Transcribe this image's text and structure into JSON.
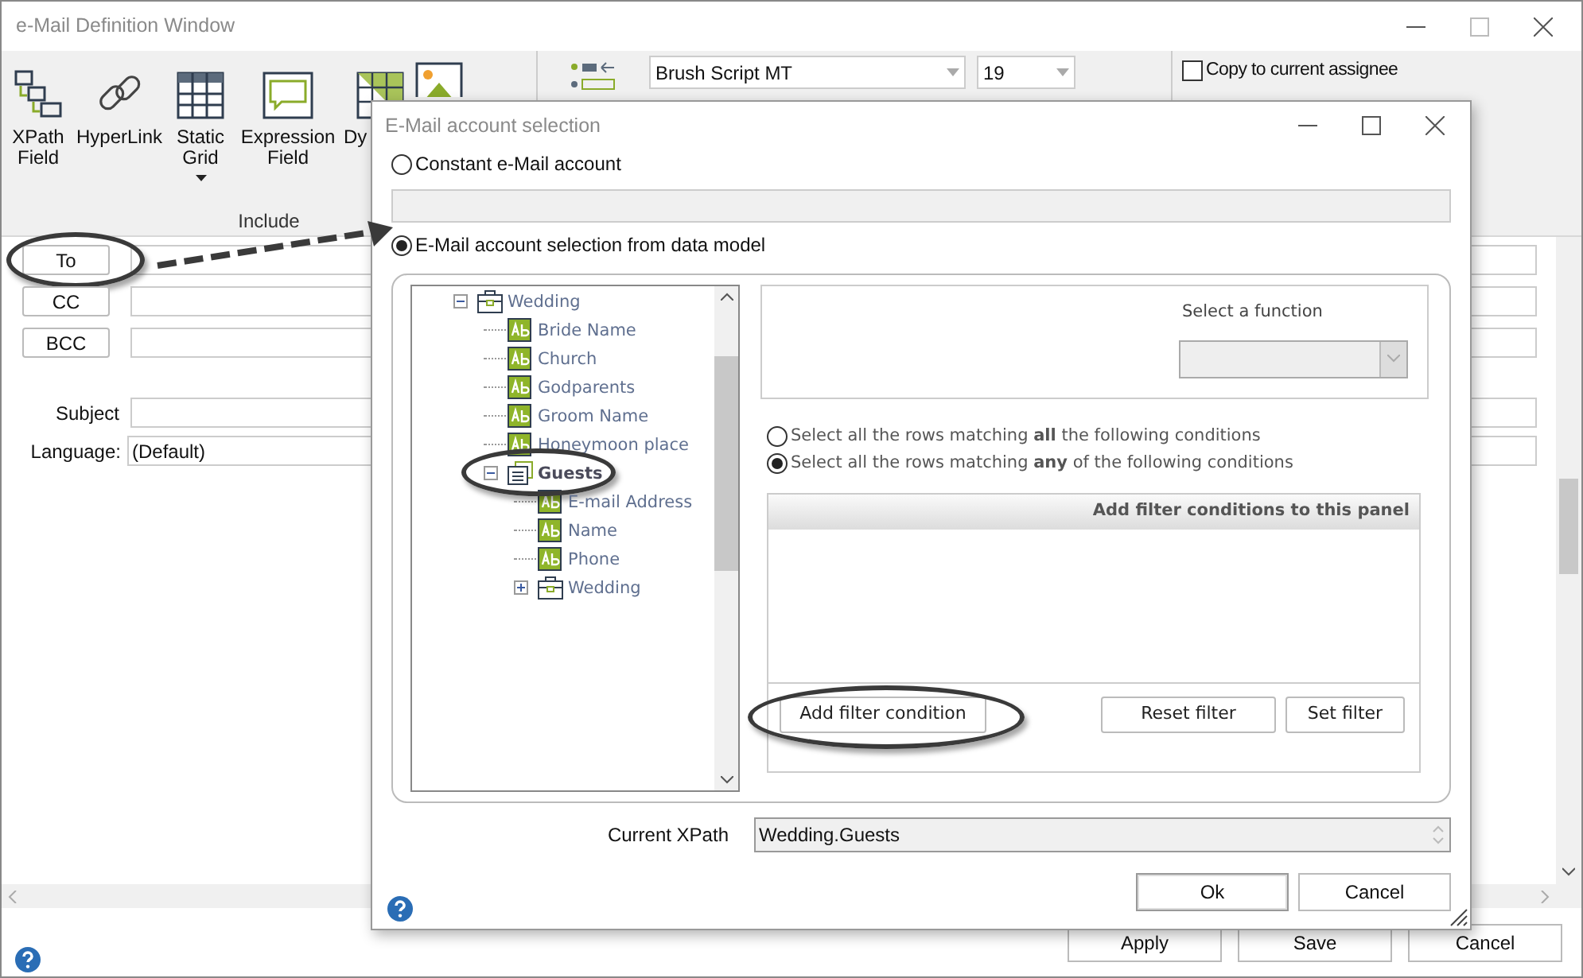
{
  "window": {
    "title": "e-Mail Definition Window"
  },
  "ribbon": {
    "items": [
      {
        "kind": "xpath",
        "lines": [
          "XPath",
          "Field"
        ]
      },
      {
        "kind": "link",
        "lines": [
          "HyperLink"
        ]
      },
      {
        "kind": "grid",
        "lines": [
          "Static",
          "Grid"
        ],
        "dropdown": true
      },
      {
        "kind": "expression",
        "lines": [
          "Expression",
          "Field"
        ]
      },
      {
        "kind": "dyngrid",
        "lines": [
          "Dy"
        ]
      },
      {
        "kind": "image"
      }
    ],
    "group_label": "Include",
    "font": {
      "value": "Brush Script MT"
    },
    "size": {
      "value": "19"
    },
    "copy_to_assignee": {
      "label": "Copy to current assignee",
      "checked": false
    }
  },
  "recipients": [
    {
      "label": "To",
      "highlighted": true
    },
    {
      "label": "CC",
      "highlighted": false
    },
    {
      "label": "BCC",
      "highlighted": false
    }
  ],
  "subject": {
    "label": "Subject"
  },
  "language": {
    "label": "Language:",
    "value": "(Default)"
  },
  "footer_buttons": [
    "Apply",
    "Save",
    "Cancel"
  ],
  "dialog": {
    "title": "E-Mail account selection",
    "sources": [
      {
        "label": "Constant e-Mail account",
        "selected": false
      },
      {
        "label": "E-Mail account selection from data model",
        "selected": true
      }
    ],
    "tree": [
      {
        "label": "Wedding",
        "kind": "group",
        "expanded": true,
        "selected": false,
        "highlighted": false,
        "children": [
          {
            "label": "Bride Name",
            "kind": "field",
            "selected": false,
            "highlighted": false
          },
          {
            "label": "Church",
            "kind": "field",
            "selected": false,
            "highlighted": false
          },
          {
            "label": "Godparents",
            "kind": "field",
            "selected": false,
            "highlighted": false
          },
          {
            "label": "Groom Name",
            "kind": "field",
            "selected": false,
            "highlighted": false
          },
          {
            "label": "Honeymoon place",
            "kind": "field",
            "selected": false,
            "highlighted": false
          },
          {
            "label": "Guests",
            "kind": "list",
            "expanded": true,
            "selected": true,
            "highlighted": true,
            "children": [
              {
                "label": "E-mail Address",
                "kind": "field",
                "selected": false,
                "highlighted": false
              },
              {
                "label": "Name",
                "kind": "field",
                "selected": false,
                "highlighted": false
              },
              {
                "label": "Phone",
                "kind": "field",
                "selected": false,
                "highlighted": false
              },
              {
                "label": "Wedding",
                "kind": "group",
                "expanded": false,
                "selected": false,
                "highlighted": false
              }
            ]
          }
        ]
      }
    ],
    "function": {
      "label": "Select a function",
      "disabled": true
    },
    "match_modes": [
      {
        "text": "Select all the rows matching **all** the following conditions",
        "selected": false
      },
      {
        "text": "Select all the rows matching **any** of the following conditions",
        "selected": true
      }
    ],
    "filter_panel": {
      "header": "Add filter conditions to this panel"
    },
    "filter_buttons": [
      {
        "label": "Add filter condition",
        "highlighted": true
      },
      {
        "label": "Reset filter",
        "highlighted": false
      },
      {
        "label": "Set filter",
        "highlighted": false
      }
    ],
    "xpath": {
      "label": "Current XPath",
      "value": "Wedding.Guests"
    },
    "buttons": [
      "Ok",
      "Cancel"
    ]
  }
}
